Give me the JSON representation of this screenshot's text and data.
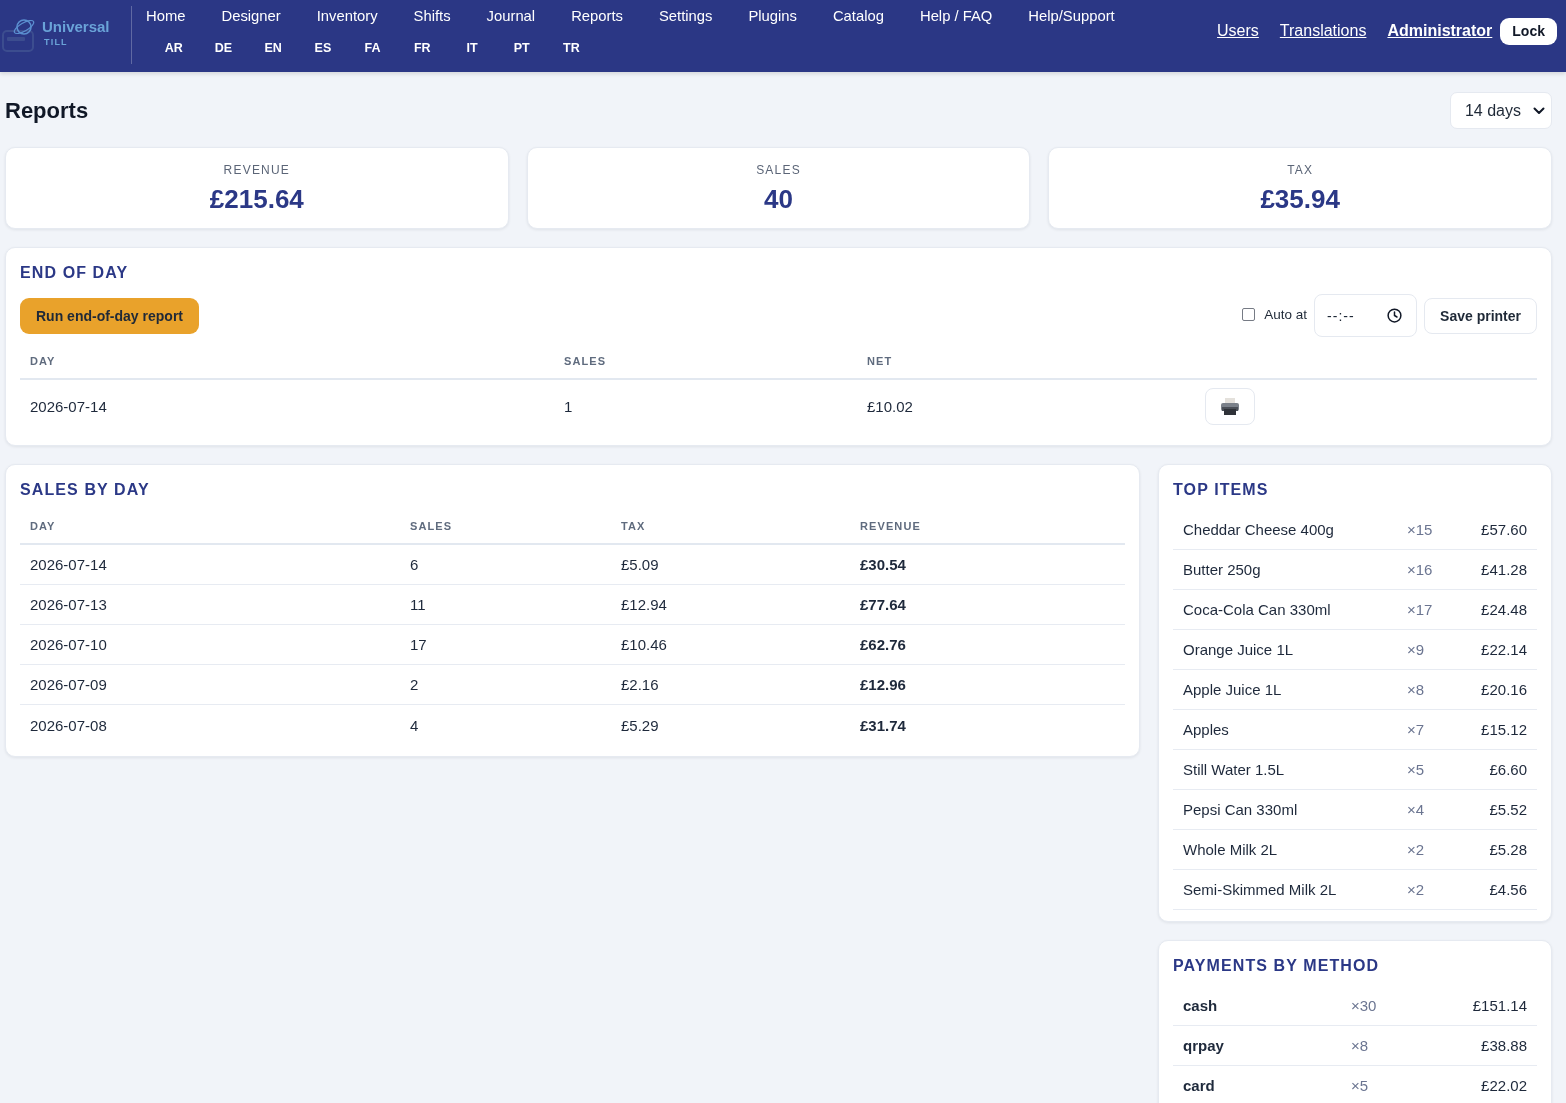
{
  "header": {
    "logo": {
      "name": "Universal",
      "subtitle": "TILL"
    },
    "nav": [
      {
        "label": "Home"
      },
      {
        "label": "Designer"
      },
      {
        "label": "Inventory"
      },
      {
        "label": "Shifts"
      },
      {
        "label": "Journal"
      },
      {
        "label": "Reports"
      },
      {
        "label": "Settings"
      },
      {
        "label": "Plugins"
      },
      {
        "label": "Catalog"
      },
      {
        "label": "Help / FAQ"
      },
      {
        "label": "Help/Support"
      }
    ],
    "languages": [
      "AR",
      "DE",
      "EN",
      "ES",
      "FA",
      "FR",
      "IT",
      "PT",
      "TR"
    ],
    "links": [
      {
        "label": "Users",
        "kind": "link"
      },
      {
        "label": "Translations",
        "kind": "link"
      },
      {
        "label": "Administrator",
        "kind": "user"
      }
    ],
    "lock_button": "Lock"
  },
  "page": {
    "title": "Reports",
    "range_select": {
      "value": "14 days"
    }
  },
  "stats": [
    {
      "label": "REVENUE",
      "value": "£215.64"
    },
    {
      "label": "SALES",
      "value": "40"
    },
    {
      "label": "TAX",
      "value": "£35.94"
    }
  ],
  "end_of_day": {
    "title": "END OF DAY",
    "run_button": "Run end-of-day report",
    "auto": {
      "label": "Auto at",
      "checked": false
    },
    "time_field": {
      "placeholder": "--:--"
    },
    "save_button": "Save printer",
    "columns": [
      "DAY",
      "SALES",
      "NET"
    ],
    "rows": [
      {
        "day": "2026-07-14",
        "sales": "1",
        "net": "£10.02"
      }
    ]
  },
  "sales_by_day": {
    "title": "SALES BY DAY",
    "columns": [
      "DAY",
      "SALES",
      "TAX",
      "REVENUE"
    ],
    "rows": [
      {
        "day": "2026-07-14",
        "sales": "6",
        "tax": "£5.09",
        "revenue": "£30.54"
      },
      {
        "day": "2026-07-13",
        "sales": "11",
        "tax": "£12.94",
        "revenue": "£77.64"
      },
      {
        "day": "2026-07-10",
        "sales": "17",
        "tax": "£10.46",
        "revenue": "£62.76"
      },
      {
        "day": "2026-07-09",
        "sales": "2",
        "tax": "£2.16",
        "revenue": "£12.96"
      },
      {
        "day": "2026-07-08",
        "sales": "4",
        "tax": "£5.29",
        "revenue": "£31.74"
      }
    ]
  },
  "top_items": {
    "title": "TOP ITEMS",
    "rows": [
      {
        "name": "Cheddar Cheese 400g",
        "qty": "×15",
        "amount": "£57.60"
      },
      {
        "name": "Butter 250g",
        "qty": "×16",
        "amount": "£41.28"
      },
      {
        "name": "Coca-Cola Can 330ml",
        "qty": "×17",
        "amount": "£24.48"
      },
      {
        "name": "Orange Juice 1L",
        "qty": "×9",
        "amount": "£22.14"
      },
      {
        "name": "Apple Juice 1L",
        "qty": "×8",
        "amount": "£20.16"
      },
      {
        "name": "Apples",
        "qty": "×7",
        "amount": "£15.12"
      },
      {
        "name": "Still Water 1.5L",
        "qty": "×5",
        "amount": "£6.60"
      },
      {
        "name": "Pepsi Can 330ml",
        "qty": "×4",
        "amount": "£5.52"
      },
      {
        "name": "Whole Milk 2L",
        "qty": "×2",
        "amount": "£5.28"
      },
      {
        "name": "Semi-Skimmed Milk 2L",
        "qty": "×2",
        "amount": "£4.56"
      }
    ]
  },
  "payments_by_method": {
    "title": "PAYMENTS BY METHOD",
    "rows": [
      {
        "name": "cash",
        "qty": "×30",
        "amount": "£151.14"
      },
      {
        "name": "qrpay",
        "qty": "×8",
        "amount": "£38.88"
      },
      {
        "name": "card",
        "qty": "×5",
        "amount": "£22.02"
      }
    ]
  }
}
